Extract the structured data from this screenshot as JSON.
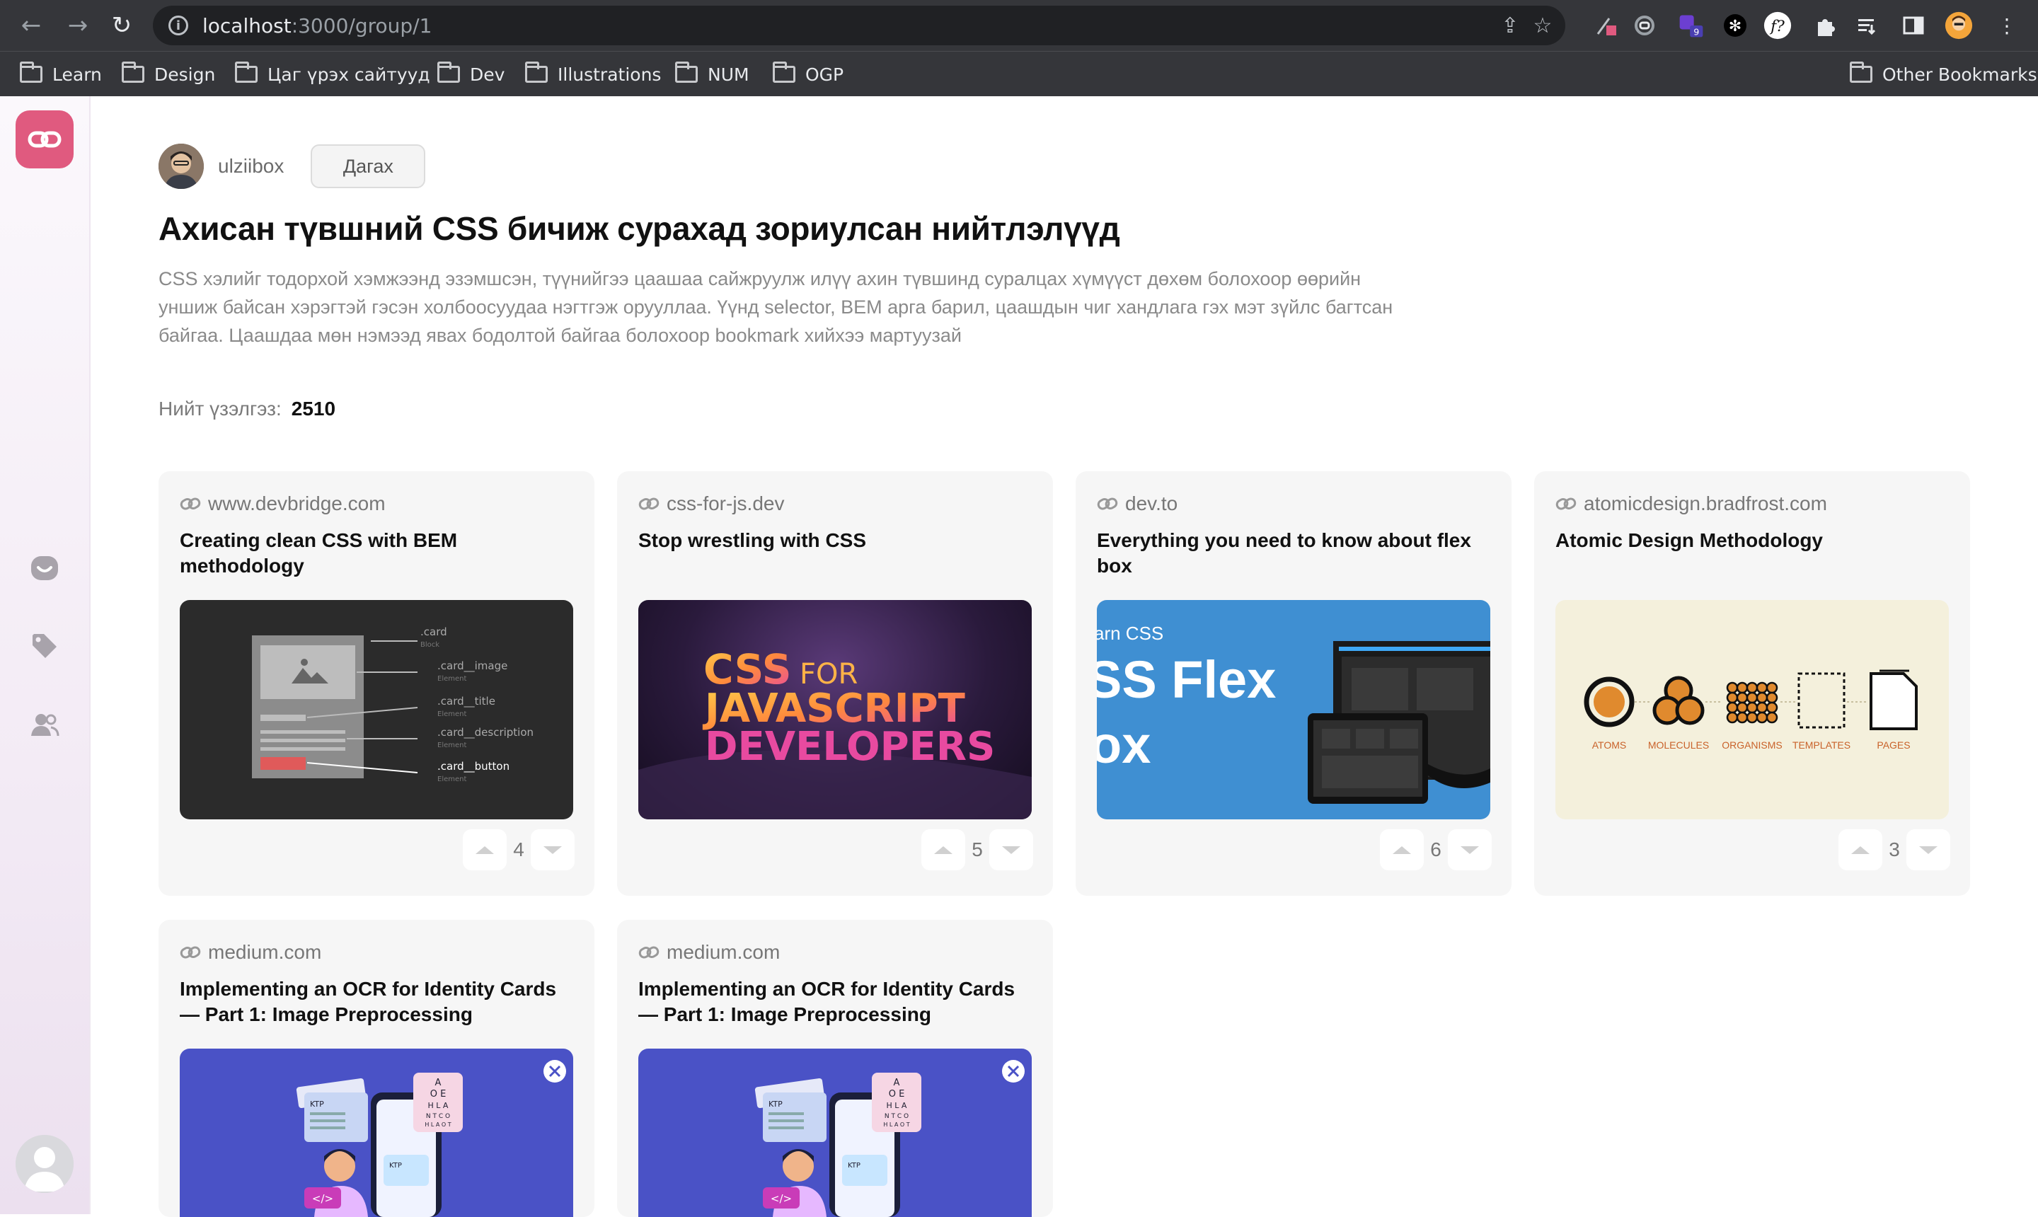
{
  "browser": {
    "url_host": "localhost",
    "url_path": ":3000/group/1",
    "bookmarks": [
      "Learn",
      "Design",
      "Цаг үрэх сайтууд",
      "Dev",
      "Illustrations",
      "NUM",
      "OGP"
    ],
    "other_bookmarks": "Other Bookmarks",
    "extension_badge": "9"
  },
  "group": {
    "owner": "ulziibox",
    "follow_label": "Дагах",
    "title": "Ахисан түвшний CSS бичиж сурахад зориулсан нийтлэлүүд",
    "description": "CSS хэлийг тодорхой хэмжээнд эзэмшсэн, түүнийгээ цаашаа сайжруулж илүү ахин түвшинд суралцах хүмүүст дөхөм болохоор өөрийн уншиж байсан хэрэгтэй гэсэн холбоосуудаа нэгтгэж орууллаа. Үүнд selector, BEM арга барил, цаашдын чиг хандлага гэх мэт зүйлс багтсан байгаа. Цаашдаа мөн нэмээд явах бодолтой байгаа болохоор bookmark хийхээ мартуузай",
    "views_label": "Нийт үзэлгэз:",
    "views_value": "2510"
  },
  "cards": [
    {
      "domain": "www.devbridge.com",
      "title": "Creating clean CSS with BEM methodology",
      "votes": "4",
      "thumb_labels": {
        "card": ".card",
        "card_sub": "Block",
        "image": ".card__image",
        "title": ".card__title",
        "description": ".card__description",
        "button": ".card__button",
        "element": "Element"
      }
    },
    {
      "domain": "css-for-js.dev",
      "title": "Stop wrestling with CSS",
      "votes": "5",
      "thumb_labels": {
        "line1a": "CSS",
        "line1b": "FOR",
        "line2": "JAVASCRIPT",
        "line3": "DEVELOPERS"
      }
    },
    {
      "domain": "dev.to",
      "title": "Everything you need to know about flex box",
      "votes": "6",
      "thumb_labels": {
        "small": "arn CSS",
        "big1": "SS Flex",
        "big2": "ox"
      }
    },
    {
      "domain": "atomicdesign.bradfrost.com",
      "title": "Atomic Design Methodology",
      "votes": "3",
      "thumb_labels": {
        "atoms": "ATOMS",
        "molecules": "MOLECULES",
        "organisms": "ORGANISMS",
        "templates": "TEMPLATES",
        "pages": "PAGES"
      }
    },
    {
      "domain": "medium.com",
      "title": "Implementing an OCR for Identity Cards — Part 1: Image Preprocessing",
      "thumb_labels": {
        "ktp": "KTP",
        "ktp2": "KTP",
        "code": "</>",
        "chart_l1": "A",
        "chart_l2": "O E",
        "chart_l3": "H L A",
        "chart_l4": "N T C O",
        "chart_l5": "H L A O T"
      }
    },
    {
      "domain": "medium.com",
      "title": "Implementing an OCR for Identity Cards — Part 1: Image Preprocessing",
      "thumb_labels": {
        "ktp": "KTP",
        "ktp2": "KTP",
        "code": "</>",
        "chart_l1": "A",
        "chart_l2": "O E",
        "chart_l3": "H L A",
        "chart_l4": "N T C O",
        "chart_l5": "H L A O T"
      }
    }
  ],
  "colors": {
    "brand": "#e05a7f",
    "card_bg": "#f6f6f6",
    "ocr_bg": "#4a52c6",
    "flex_bg": "#3f8fd2",
    "atomic_bg": "#f4f0dc"
  }
}
